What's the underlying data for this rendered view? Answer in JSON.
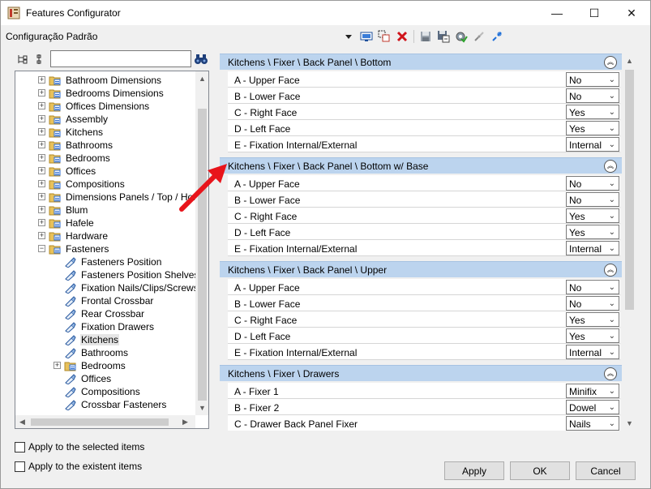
{
  "window": {
    "title": "Features Configurator",
    "minimize_glyph": "—",
    "maximize_glyph": "☐",
    "close_glyph": "✕"
  },
  "config_label": "Configuração Padrão",
  "toolbar": {
    "icons": [
      "dropdown-arrow-icon",
      "monitor-icon",
      "select-copy-icon",
      "delete-icon",
      "save-icon",
      "save-as-icon",
      "settings-check-icon",
      "link-icon",
      "unlink-icon"
    ]
  },
  "search": {
    "value": "",
    "placeholder": ""
  },
  "tree": {
    "items": [
      {
        "label": "Bathroom Dimensions",
        "level": 0,
        "type": "folder",
        "expander": "+"
      },
      {
        "label": "Bedrooms Dimensions",
        "level": 0,
        "type": "folder",
        "expander": "+"
      },
      {
        "label": "Offices Dimensions",
        "level": 0,
        "type": "folder",
        "expander": "+"
      },
      {
        "label": "Assembly",
        "level": 0,
        "type": "folder",
        "expander": "+"
      },
      {
        "label": "Kitchens",
        "level": 0,
        "type": "folder",
        "expander": "+"
      },
      {
        "label": "Bathrooms",
        "level": 0,
        "type": "folder",
        "expander": "+"
      },
      {
        "label": "Bedrooms",
        "level": 0,
        "type": "folder",
        "expander": "+"
      },
      {
        "label": "Offices",
        "level": 0,
        "type": "folder",
        "expander": "+"
      },
      {
        "label": "Compositions",
        "level": 0,
        "type": "folder",
        "expander": "+"
      },
      {
        "label": "Dimensions Panels / Top / Hone",
        "level": 0,
        "type": "folder",
        "expander": "+"
      },
      {
        "label": "Blum",
        "level": 0,
        "type": "folder",
        "expander": "+"
      },
      {
        "label": "Hafele",
        "level": 0,
        "type": "folder",
        "expander": "+"
      },
      {
        "label": "Hardware",
        "level": 0,
        "type": "folder",
        "expander": "+"
      },
      {
        "label": "Fasteners",
        "level": 0,
        "type": "folder",
        "expander": "−"
      },
      {
        "label": "Fasteners Position",
        "level": 1,
        "type": "leaf",
        "expander": ""
      },
      {
        "label": "Fasteners Position Shelves",
        "level": 1,
        "type": "leaf",
        "expander": ""
      },
      {
        "label": "Fixation Nails/Clips/Screws",
        "level": 1,
        "type": "leaf",
        "expander": ""
      },
      {
        "label": "Frontal Crossbar",
        "level": 1,
        "type": "leaf",
        "expander": ""
      },
      {
        "label": "Rear Crossbar",
        "level": 1,
        "type": "leaf",
        "expander": ""
      },
      {
        "label": "Fixation Drawers",
        "level": 1,
        "type": "leaf",
        "expander": ""
      },
      {
        "label": "Kitchens",
        "level": 1,
        "type": "leaf",
        "expander": "",
        "selected": true
      },
      {
        "label": "Bathrooms",
        "level": 1,
        "type": "leaf",
        "expander": ""
      },
      {
        "label": "Bedrooms",
        "level": 1,
        "type": "folder",
        "expander": "+"
      },
      {
        "label": "Offices",
        "level": 1,
        "type": "leaf",
        "expander": ""
      },
      {
        "label": "Compositions",
        "level": 1,
        "type": "leaf",
        "expander": ""
      },
      {
        "label": "Crossbar Fasteners",
        "level": 1,
        "type": "leaf",
        "expander": ""
      }
    ]
  },
  "checkboxes": {
    "selected_items": "Apply to the selected items",
    "existent_items": "Apply to the existent items"
  },
  "groups": [
    {
      "title": "Kitchens \\ Fixer \\ Back Panel \\ Bottom",
      "rows": [
        {
          "label": "A - Upper Face",
          "value": "No"
        },
        {
          "label": "B - Lower Face",
          "value": "No"
        },
        {
          "label": "C - Right Face",
          "value": "Yes"
        },
        {
          "label": "D - Left Face",
          "value": "Yes"
        },
        {
          "label": "E - Fixation Internal/External",
          "value": "Internal"
        }
      ]
    },
    {
      "title": "Kitchens \\ Fixer \\ Back Panel \\ Bottom w/ Base",
      "rows": [
        {
          "label": "A - Upper Face",
          "value": "No"
        },
        {
          "label": "B - Lower Face",
          "value": "No"
        },
        {
          "label": "C - Right Face",
          "value": "Yes"
        },
        {
          "label": "D - Left Face",
          "value": "Yes"
        },
        {
          "label": "E - Fixation Internal/External",
          "value": "Internal"
        }
      ]
    },
    {
      "title": "Kitchens \\ Fixer \\ Back Panel \\ Upper",
      "rows": [
        {
          "label": "A - Upper Face",
          "value": "No"
        },
        {
          "label": "B - Lower Face",
          "value": "No"
        },
        {
          "label": "C - Right Face",
          "value": "Yes"
        },
        {
          "label": "D - Left Face",
          "value": "Yes"
        },
        {
          "label": "E - Fixation Internal/External",
          "value": "Internal"
        }
      ]
    },
    {
      "title": "Kitchens \\ Fixer \\ Drawers",
      "rows": [
        {
          "label": "A - Fixer 1",
          "value": "Minifix"
        },
        {
          "label": "B - Fixer 2",
          "value": "Dowel"
        },
        {
          "label": "C - Drawer Back Panel Fixer",
          "value": "Nails"
        }
      ]
    }
  ],
  "buttons": {
    "apply": "Apply",
    "ok": "OK",
    "cancel": "Cancel"
  },
  "colors": {
    "group_header": "#bcd4ee",
    "annotation_arrow": "#e8141b",
    "folder": "#e8c15a"
  }
}
